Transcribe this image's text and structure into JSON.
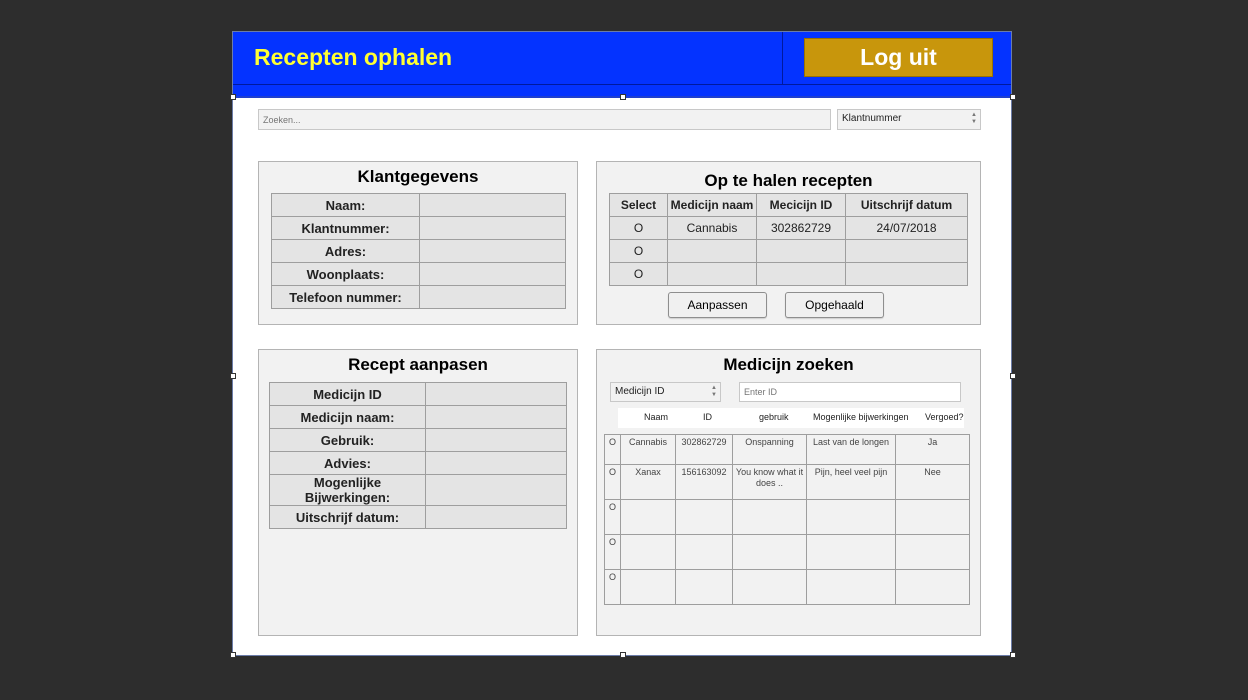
{
  "header": {
    "title": "Recepten ophalen",
    "logout_label": "Log uit",
    "colors": {
      "header_bg": "#0433ff",
      "title": "#ffff33",
      "logout_bg": "#c8960c"
    }
  },
  "search": {
    "placeholder": "Zoeken...",
    "filter_selected": "Klantnummer"
  },
  "klantgegevens": {
    "title": "Klantgegevens",
    "rows": [
      {
        "label": "Naam:",
        "value": ""
      },
      {
        "label": "Klantnummer:",
        "value": ""
      },
      {
        "label": "Adres:",
        "value": ""
      },
      {
        "label": "Woonplaats:",
        "value": ""
      },
      {
        "label": "Telefoon nummer:",
        "value": ""
      }
    ]
  },
  "recepten": {
    "title": "Op te halen recepten",
    "columns": [
      "Select",
      "Medicijn naam",
      "Mecicijn ID",
      "Uitschrijf datum"
    ],
    "rows": [
      {
        "select": "O",
        "naam": "Cannabis",
        "id": "302862729",
        "datum": "24/07/2018"
      },
      {
        "select": "O",
        "naam": "",
        "id": "",
        "datum": ""
      },
      {
        "select": "O",
        "naam": "",
        "id": "",
        "datum": ""
      }
    ],
    "btn_aanpassen": "Aanpassen",
    "btn_opgehaald": "Opgehaald"
  },
  "recept_aanpassen": {
    "title": "Recept aanpasen",
    "rows": [
      {
        "label": "Medicijn ID",
        "value": ""
      },
      {
        "label": "Medicijn naam:",
        "value": ""
      },
      {
        "label": "Gebruik:",
        "value": ""
      },
      {
        "label": "Advies:",
        "value": ""
      },
      {
        "label": "Mogenlijke Bijwerkingen:",
        "value": ""
      },
      {
        "label": "Uitschrijf datum:",
        "value": ""
      }
    ]
  },
  "medicijn_zoeken": {
    "title": "Medicijn zoeken",
    "filter_selected": "Medicijn ID",
    "id_placeholder": "Enter ID",
    "columns": [
      "Naam",
      "ID",
      "gebruik",
      "Mogenlijke bijwerkingen",
      "Vergoed?"
    ],
    "rows": [
      {
        "select": "O",
        "naam": "Cannabis",
        "id": "302862729",
        "gebruik": "Onspanning",
        "bijwerkingen": "Last van de longen",
        "vergoed": "Ja"
      },
      {
        "select": "O",
        "naam": "Xanax",
        "id": "156163092",
        "gebruik": "You know what it does ..",
        "bijwerkingen": "Pijn, heel veel pijn",
        "vergoed": "Nee"
      },
      {
        "select": "O",
        "naam": "",
        "id": "",
        "gebruik": "",
        "bijwerkingen": "",
        "vergoed": ""
      },
      {
        "select": "O",
        "naam": "",
        "id": "",
        "gebruik": "",
        "bijwerkingen": "",
        "vergoed": ""
      },
      {
        "select": "O",
        "naam": "",
        "id": "",
        "gebruik": "",
        "bijwerkingen": "",
        "vergoed": ""
      }
    ]
  }
}
